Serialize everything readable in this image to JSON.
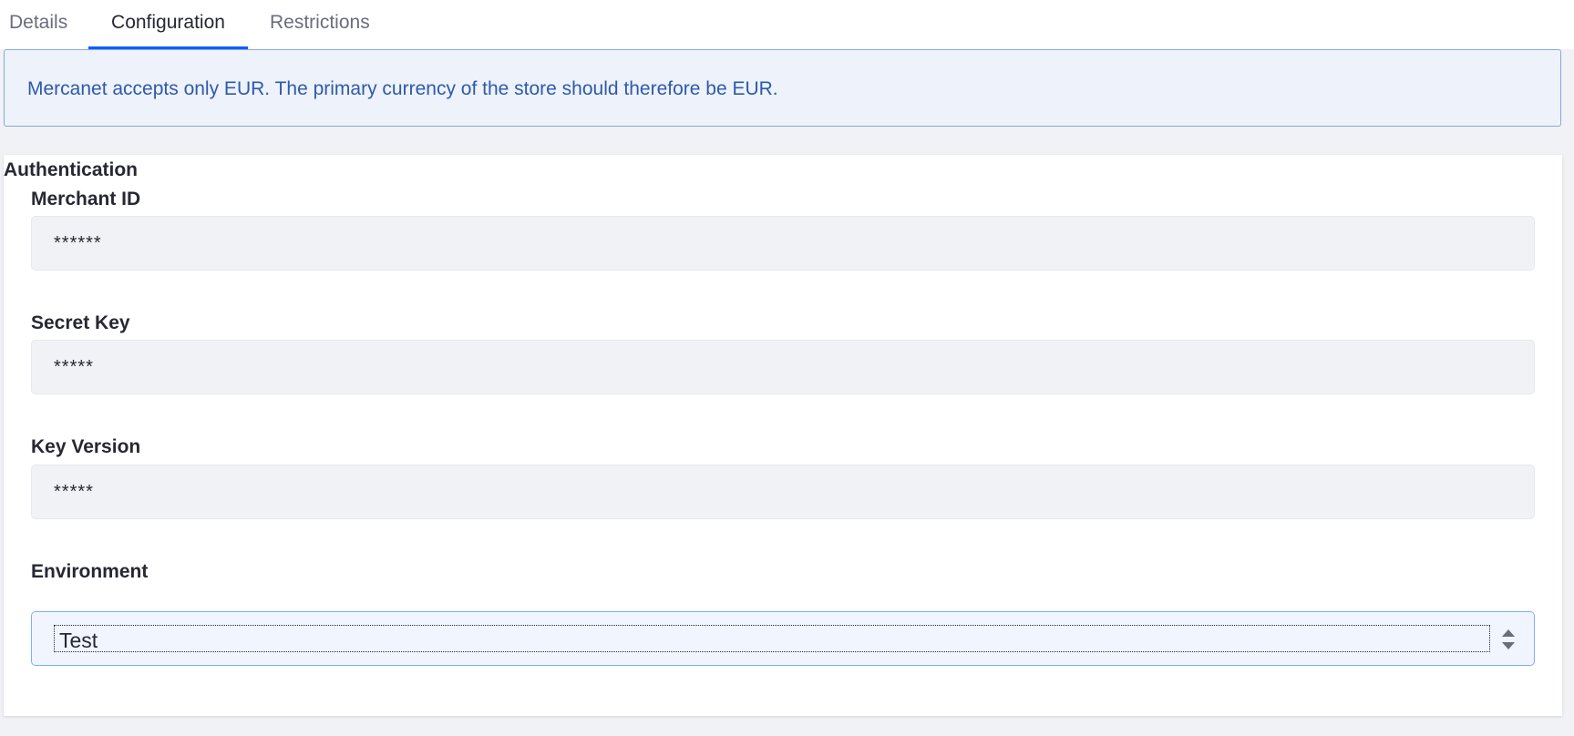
{
  "tabs": [
    {
      "label": "Details",
      "active": false
    },
    {
      "label": "Configuration",
      "active": true
    },
    {
      "label": "Restrictions",
      "active": false
    }
  ],
  "alert": {
    "message": "Mercanet accepts only EUR. The primary currency of the store should therefore be EUR."
  },
  "section": {
    "title": "Authentication",
    "fields": {
      "merchant_id": {
        "label": "Merchant ID",
        "value": "******"
      },
      "secret_key": {
        "label": "Secret Key",
        "value": "*****"
      },
      "key_version": {
        "label": "Key Version",
        "value": "*****"
      },
      "environment": {
        "label": "Environment",
        "value": "Test"
      }
    }
  },
  "icons": {
    "select_arrows": "sort-arrows-icon"
  },
  "colors": {
    "accent": "#0b5fff",
    "alert_bg": "#eef2fa",
    "alert_border": "#89a7e0",
    "alert_text": "#2e5aac",
    "input_bg": "#f1f2f5",
    "select_focus_bg": "#f0f5ff"
  }
}
